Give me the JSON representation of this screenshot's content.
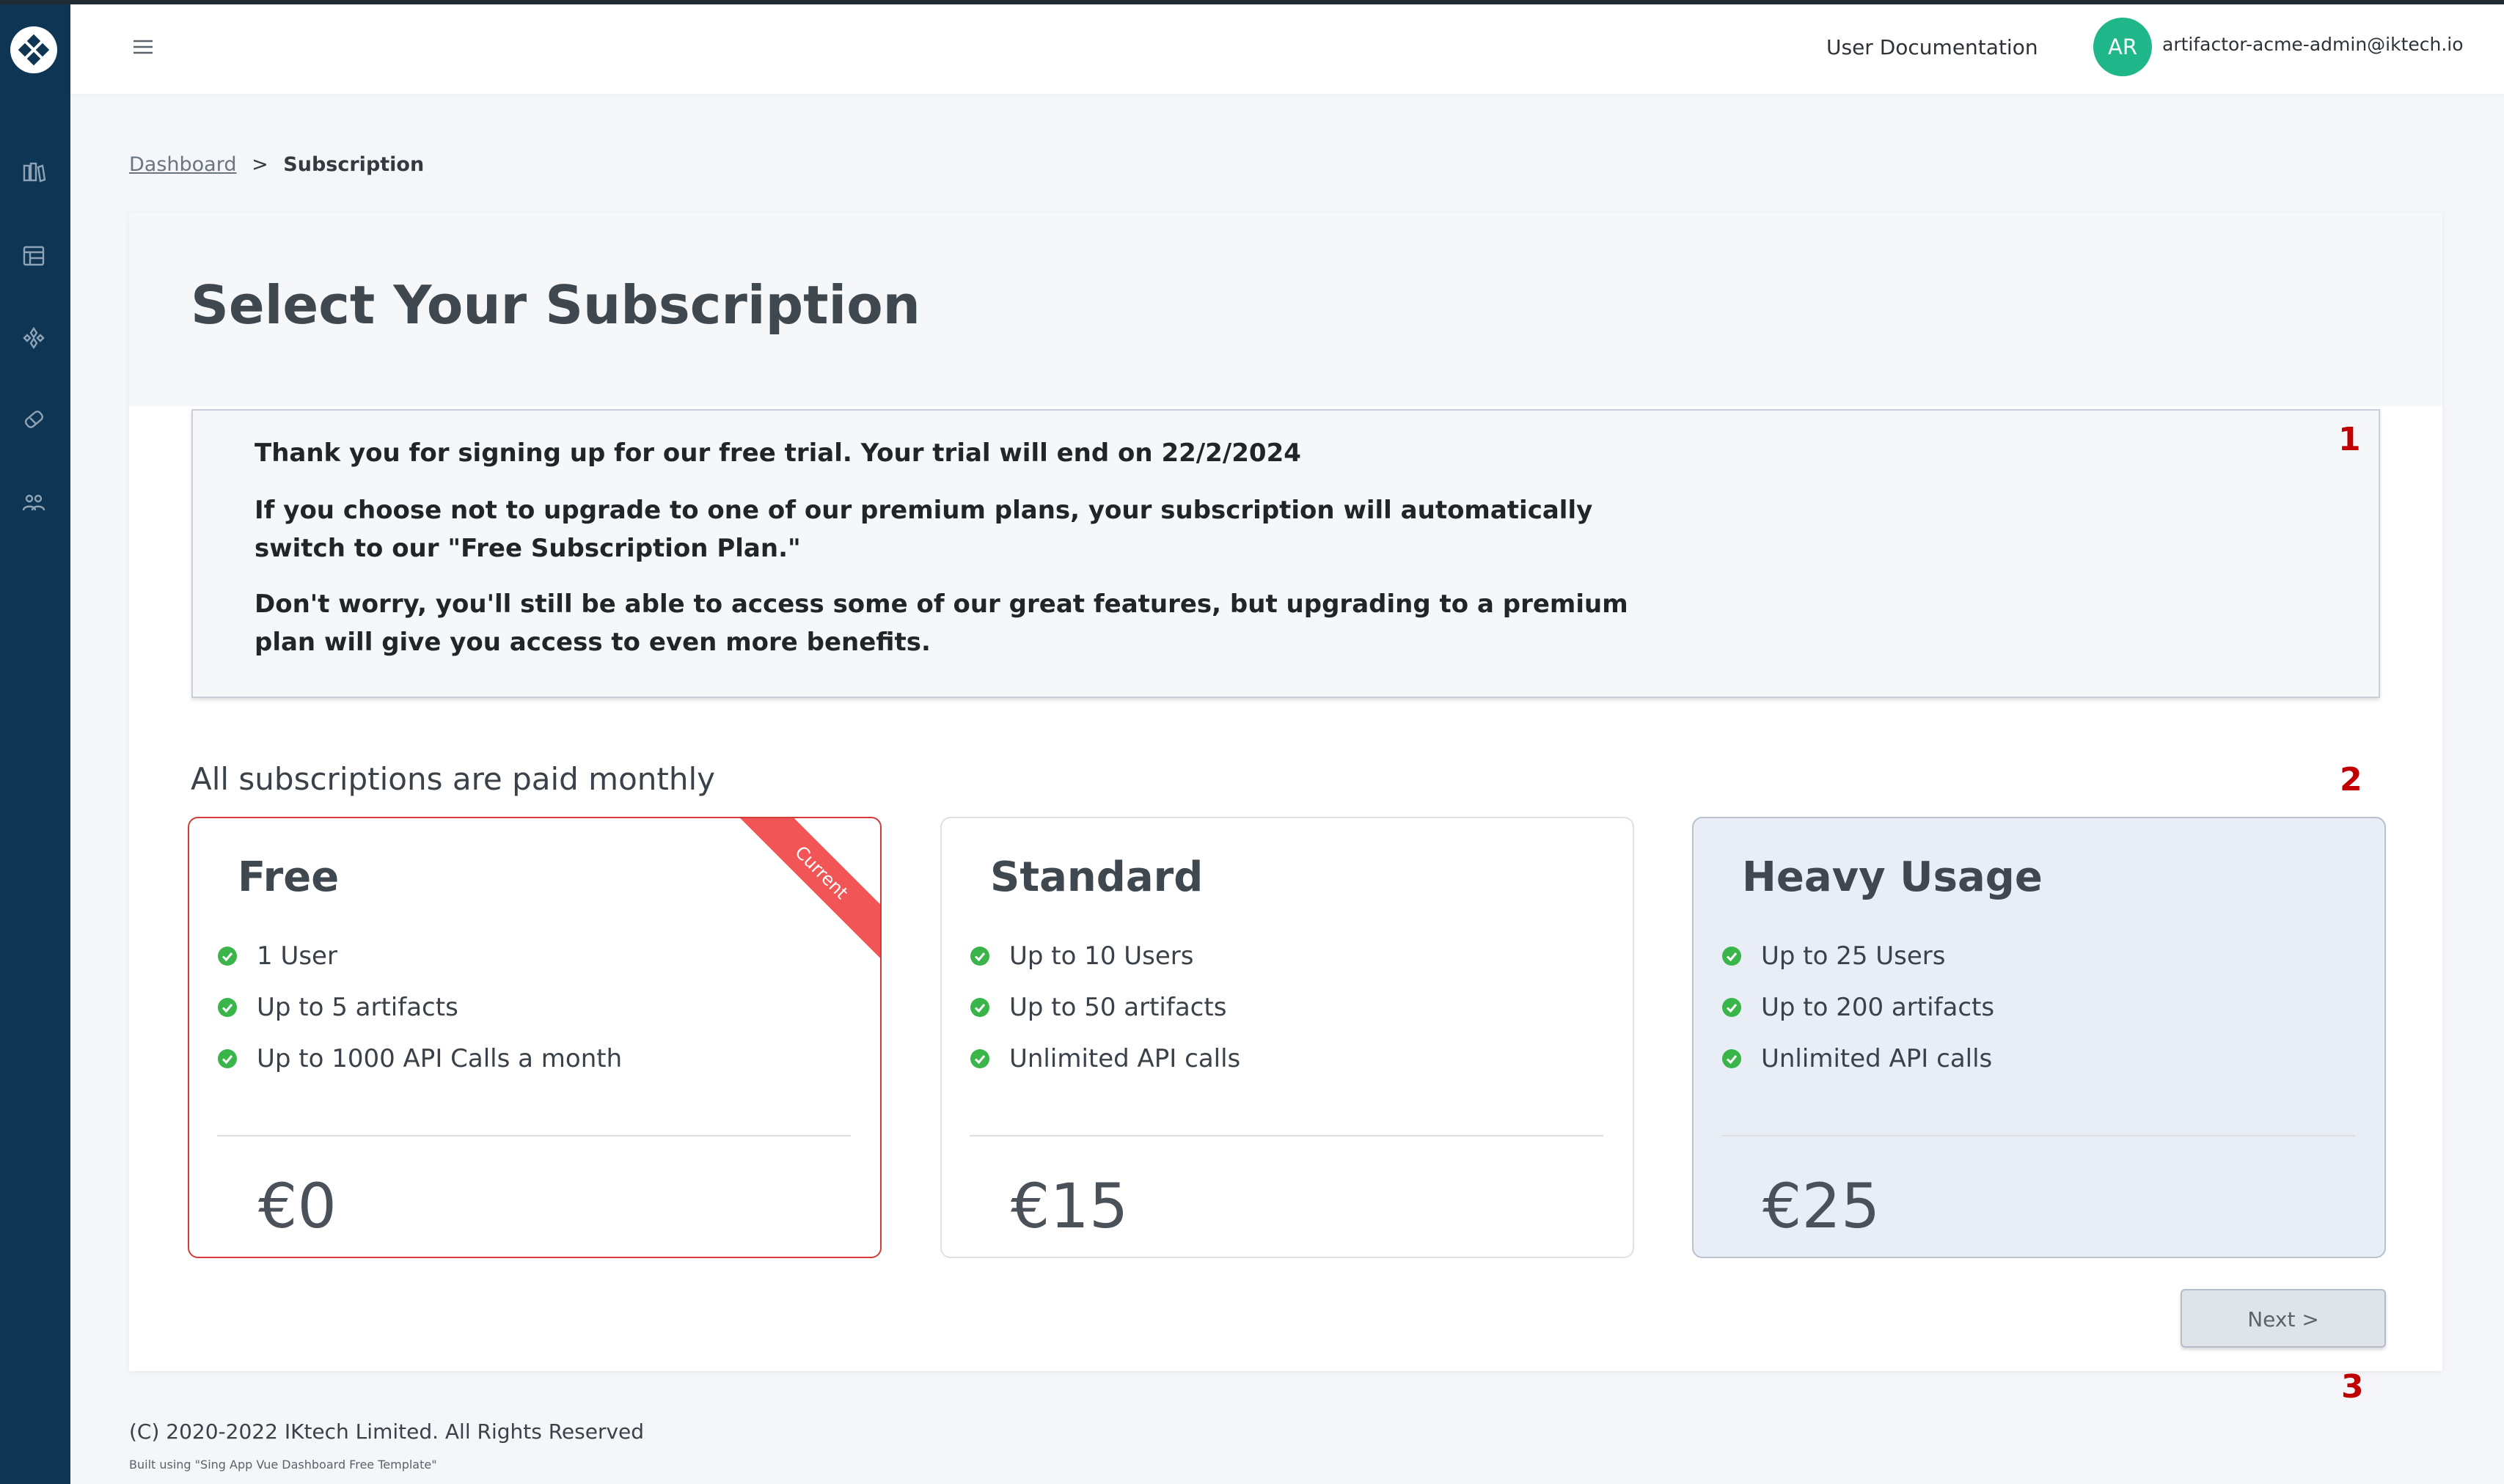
{
  "colors": {
    "sidebar": "#0e3554",
    "accent_green": "#1fb78a",
    "check_green": "#3ab54a",
    "current_border": "#d33a3a",
    "ribbon": "#f25555",
    "annotation_marker": "#c00000"
  },
  "sidebar": {
    "logo_icon": "diamond-logo-icon",
    "items": [
      {
        "icon": "library-icon"
      },
      {
        "icon": "table-icon"
      },
      {
        "icon": "component-icon"
      },
      {
        "icon": "tag-icon"
      },
      {
        "icon": "users-icon"
      }
    ]
  },
  "header": {
    "menu_icon": "hamburger-icon",
    "doc_link": "User Documentation",
    "avatar_initials": "AR",
    "user_email": "artifactor-acme-admin@iktech.io"
  },
  "breadcrumb": {
    "parent": "Dashboard",
    "separator": ">",
    "current": "Subscription"
  },
  "page": {
    "title": "Select Your Subscription"
  },
  "notice": {
    "line1": "Thank you for signing up for our free trial. Your trial will end on 22/2/2024",
    "line2": "If you choose not to upgrade to one of our premium plans, your subscription will automatically switch to our \"Free Subscription Plan.\"",
    "line3": "Don't worry, you'll still be able to access some of our great features, but upgrading to a premium plan will give you access to even more benefits."
  },
  "markers": [
    "1",
    "2",
    "3"
  ],
  "billing_note": "All subscriptions are paid monthly",
  "plans": [
    {
      "name": "Free",
      "ribbon": "Current",
      "features": [
        "1 User",
        "Up to 5 artifacts",
        "Up to 1000 API Calls a month"
      ],
      "price": "€0"
    },
    {
      "name": "Standard",
      "features": [
        "Up to 10 Users",
        "Up to 50 artifacts",
        "Unlimited API calls"
      ],
      "price": "€15"
    },
    {
      "name": "Heavy Usage",
      "features": [
        "Up to 25 Users",
        "Up to 200 artifacts",
        "Unlimited API calls"
      ],
      "price": "€25"
    }
  ],
  "actions": {
    "next_label": "Next >"
  },
  "footer": {
    "copyright": "(C) 2020-2022 IKtech Limited. All Rights Reserved",
    "built_with": "Built using \"Sing App Vue Dashboard Free Template\""
  }
}
